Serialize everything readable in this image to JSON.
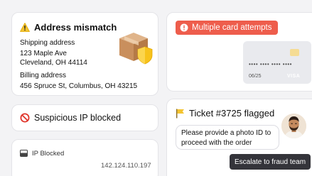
{
  "address_card": {
    "title": "Address mismatch",
    "shipping_label": "Shipping address",
    "shipping_line1": "123 Maple Ave",
    "shipping_line2": "Cleveland, OH 44114",
    "billing_label": "Billing address",
    "billing_line1": "456 Spruce St, Columbus, OH 43215",
    "icon": "warning-icon",
    "illustration": "package-shield"
  },
  "ip_card": {
    "title": "Suspicious IP blocked",
    "icon": "ban-icon"
  },
  "ip_blocked_card": {
    "label": "IP Blocked",
    "ip": "142.124.110.197",
    "icon": "monitor-icon"
  },
  "card_attempts": {
    "pill_label": "Multiple card attempts",
    "pill_color": "#ee5d4c",
    "card_number": "•••• •••• •••• ••••",
    "card_expiry": "06/25",
    "card_brand": "VISA"
  },
  "ticket_card": {
    "title": "Ticket #3725 flagged",
    "message": "Please provide a photo ID to proceed with the order",
    "button_label": "Escalate to fraud team",
    "icon": "flag-icon"
  }
}
